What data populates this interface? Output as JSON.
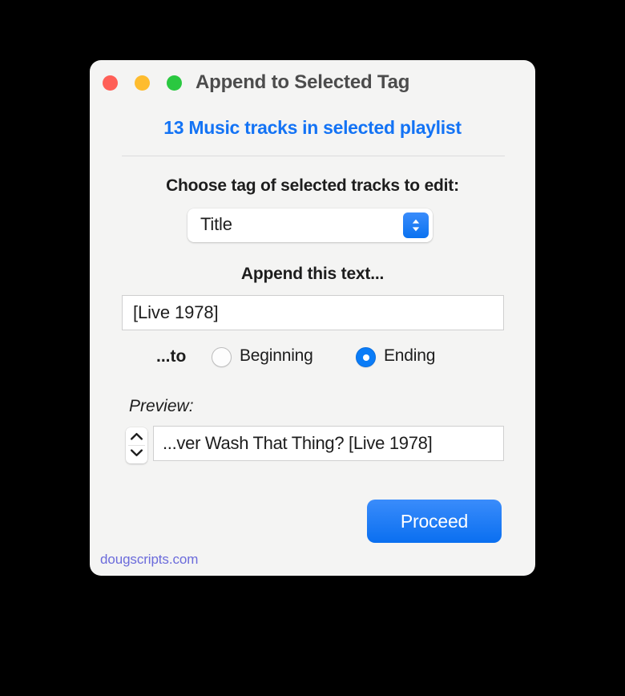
{
  "window": {
    "title": "Append to Selected Tag",
    "traffic_lights": {
      "close_color": "#ff5f57",
      "minimize_color": "#febc2e",
      "maximize_color": "#2ac840"
    },
    "background_color": "#f4f4f3"
  },
  "headline": {
    "text": "13 Music tracks in selected playlist",
    "color": "#1373f5"
  },
  "tag_section": {
    "label": "Choose tag of selected tracks to edit:",
    "popup_value": "Title",
    "popup_accent_color": "#0a72f0"
  },
  "append_section": {
    "label": "Append this text...",
    "field_value": "[Live 1978]",
    "field_placeholder": ""
  },
  "position_section": {
    "label": "...to",
    "options": [
      {
        "label": "Beginning",
        "selected": false
      },
      {
        "label": "Ending",
        "selected": true
      }
    ],
    "selected_color": "#0a7cf7"
  },
  "preview_section": {
    "label": "Preview:",
    "value": "...ver Wash That Thing? [Live 1978]",
    "stepper_up_icon": "chevron-up-icon",
    "stepper_down_icon": "chevron-down-icon"
  },
  "actions": {
    "proceed_label": "Proceed",
    "proceed_color": "#0a6ff0"
  },
  "footer": {
    "link_text": "dougscripts.com",
    "link_color": "#6b6bdb"
  }
}
